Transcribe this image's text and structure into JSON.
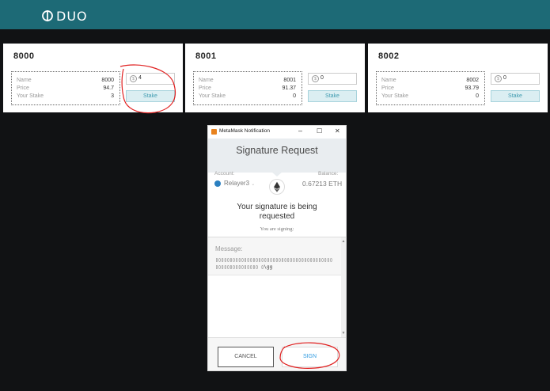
{
  "app": {
    "logo_text": "DUO",
    "logo_icon": "duo-logo-icon"
  },
  "cards": [
    {
      "title": "8000",
      "name_label": "Name",
      "name_value": "8000",
      "price_label": "Price",
      "price_value": "94.7",
      "stake_label": "Your Stake",
      "stake_value": "3",
      "input_value": "4",
      "button_label": "Stake"
    },
    {
      "title": "8001",
      "name_label": "Name",
      "name_value": "8001",
      "price_label": "Price",
      "price_value": "91.37",
      "stake_label": "Your Stake",
      "stake_value": "0",
      "input_value": "0",
      "button_label": "Stake"
    },
    {
      "title": "8002",
      "name_label": "Name",
      "name_value": "8002",
      "price_label": "Price",
      "price_value": "93.79",
      "stake_label": "Your Stake",
      "stake_value": "0",
      "input_value": "0",
      "button_label": "Stake"
    }
  ],
  "metamask": {
    "window_title": "MetaMask Notification",
    "controls": {
      "minimize": "–",
      "maximize": "☐",
      "close": "✕"
    },
    "heading": "Signature Request",
    "account_label": "Account:",
    "account_name": "Relayer3",
    "balance_label": "Balance:",
    "balance_value": "0.67213 ETH",
    "request_line1": "Your signature is being",
    "request_line2": "requested",
    "signing_label": "You are signing:",
    "message_label": "Message:",
    "message_text": "▯▯▯▯▯▯▯▯▯▯▯▯▯▯▯▯▯▯▯▯▯▯▯▯▯▯▯▯▯▯▯▯▯▯▯▯▯▯▯▯▯▯▯▯▯▯▯▯▯▯▯▯▯▯▯▯ ▯\\gg",
    "cancel_label": "CANCEL",
    "sign_label": "SIGN"
  },
  "colors": {
    "topbar": "#1d6a76",
    "background": "#111214",
    "annotation": "#e02020",
    "sign_text": "#2f9ae0"
  }
}
